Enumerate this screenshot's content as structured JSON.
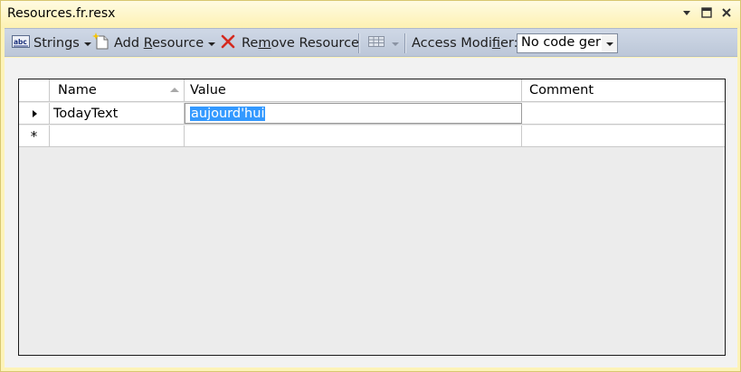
{
  "window": {
    "title": "Resources.fr.resx",
    "controls": [
      "dropdown-icon",
      "maximize-icon",
      "close-icon"
    ]
  },
  "toolbar": {
    "strings_label": "Strings",
    "add_resource_prefix": "Add ",
    "add_resource_ul": "R",
    "add_resource_suffix": "esource",
    "remove_resource_prefix": "Re",
    "remove_resource_ul": "m",
    "remove_resource_suffix": "ove Resource",
    "access_modifier_prefix": "Access Modi",
    "access_modifier_ul": "f",
    "access_modifier_suffix": "ier:",
    "access_modifier_value": "No code gene"
  },
  "grid": {
    "columns": [
      "Name",
      "Value",
      "Comment"
    ],
    "rows": [
      {
        "marker": "current",
        "name": "TodayText",
        "value": "aujourd'hui",
        "comment": ""
      }
    ],
    "new_row_marker": "*"
  },
  "colors": {
    "title_bg": "#fdf1b2",
    "toolbar_bg": "#c5cfdf",
    "selection": "#3399ff",
    "remove_icon": "#d42a1f"
  }
}
